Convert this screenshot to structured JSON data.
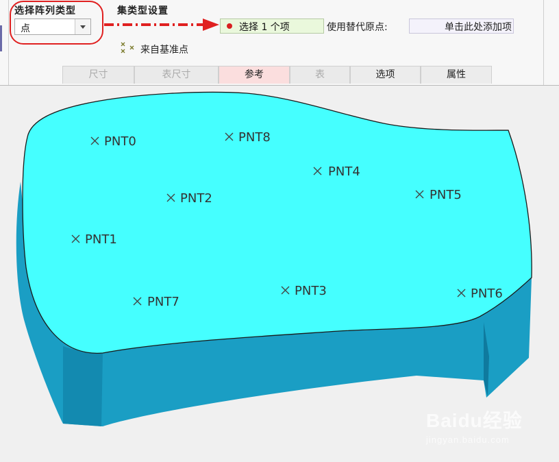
{
  "pattern_type_group": {
    "title": "选择阵列类型",
    "selected": "点"
  },
  "set_type_group": {
    "title": "集类型设置"
  },
  "reference": {
    "select_label": "选择 1 个项",
    "alt_origin_label": "使用替代原点:",
    "alt_origin_placeholder": "单击此处添加项",
    "datum_option": "来自基准点"
  },
  "tabs": [
    {
      "label": "尺寸",
      "state": "disabled"
    },
    {
      "label": "表尺寸",
      "state": "disabled"
    },
    {
      "label": "参考",
      "state": "active"
    },
    {
      "label": "表",
      "state": "disabled"
    },
    {
      "label": "选项",
      "state": "enabled"
    },
    {
      "label": "属性",
      "state": "enabled"
    }
  ],
  "points": [
    "PNT0",
    "PNT8",
    "PNT4",
    "PNT2",
    "PNT5",
    "PNT1",
    "PNT3",
    "PNT6",
    "PNT7"
  ],
  "colors": {
    "top_face": "#45ffff",
    "side_face": "#1a9ec4",
    "accent_red": "#e02020"
  },
  "watermark": {
    "brand": "Baidu经验",
    "url": "jingyan.baidu.com"
  }
}
